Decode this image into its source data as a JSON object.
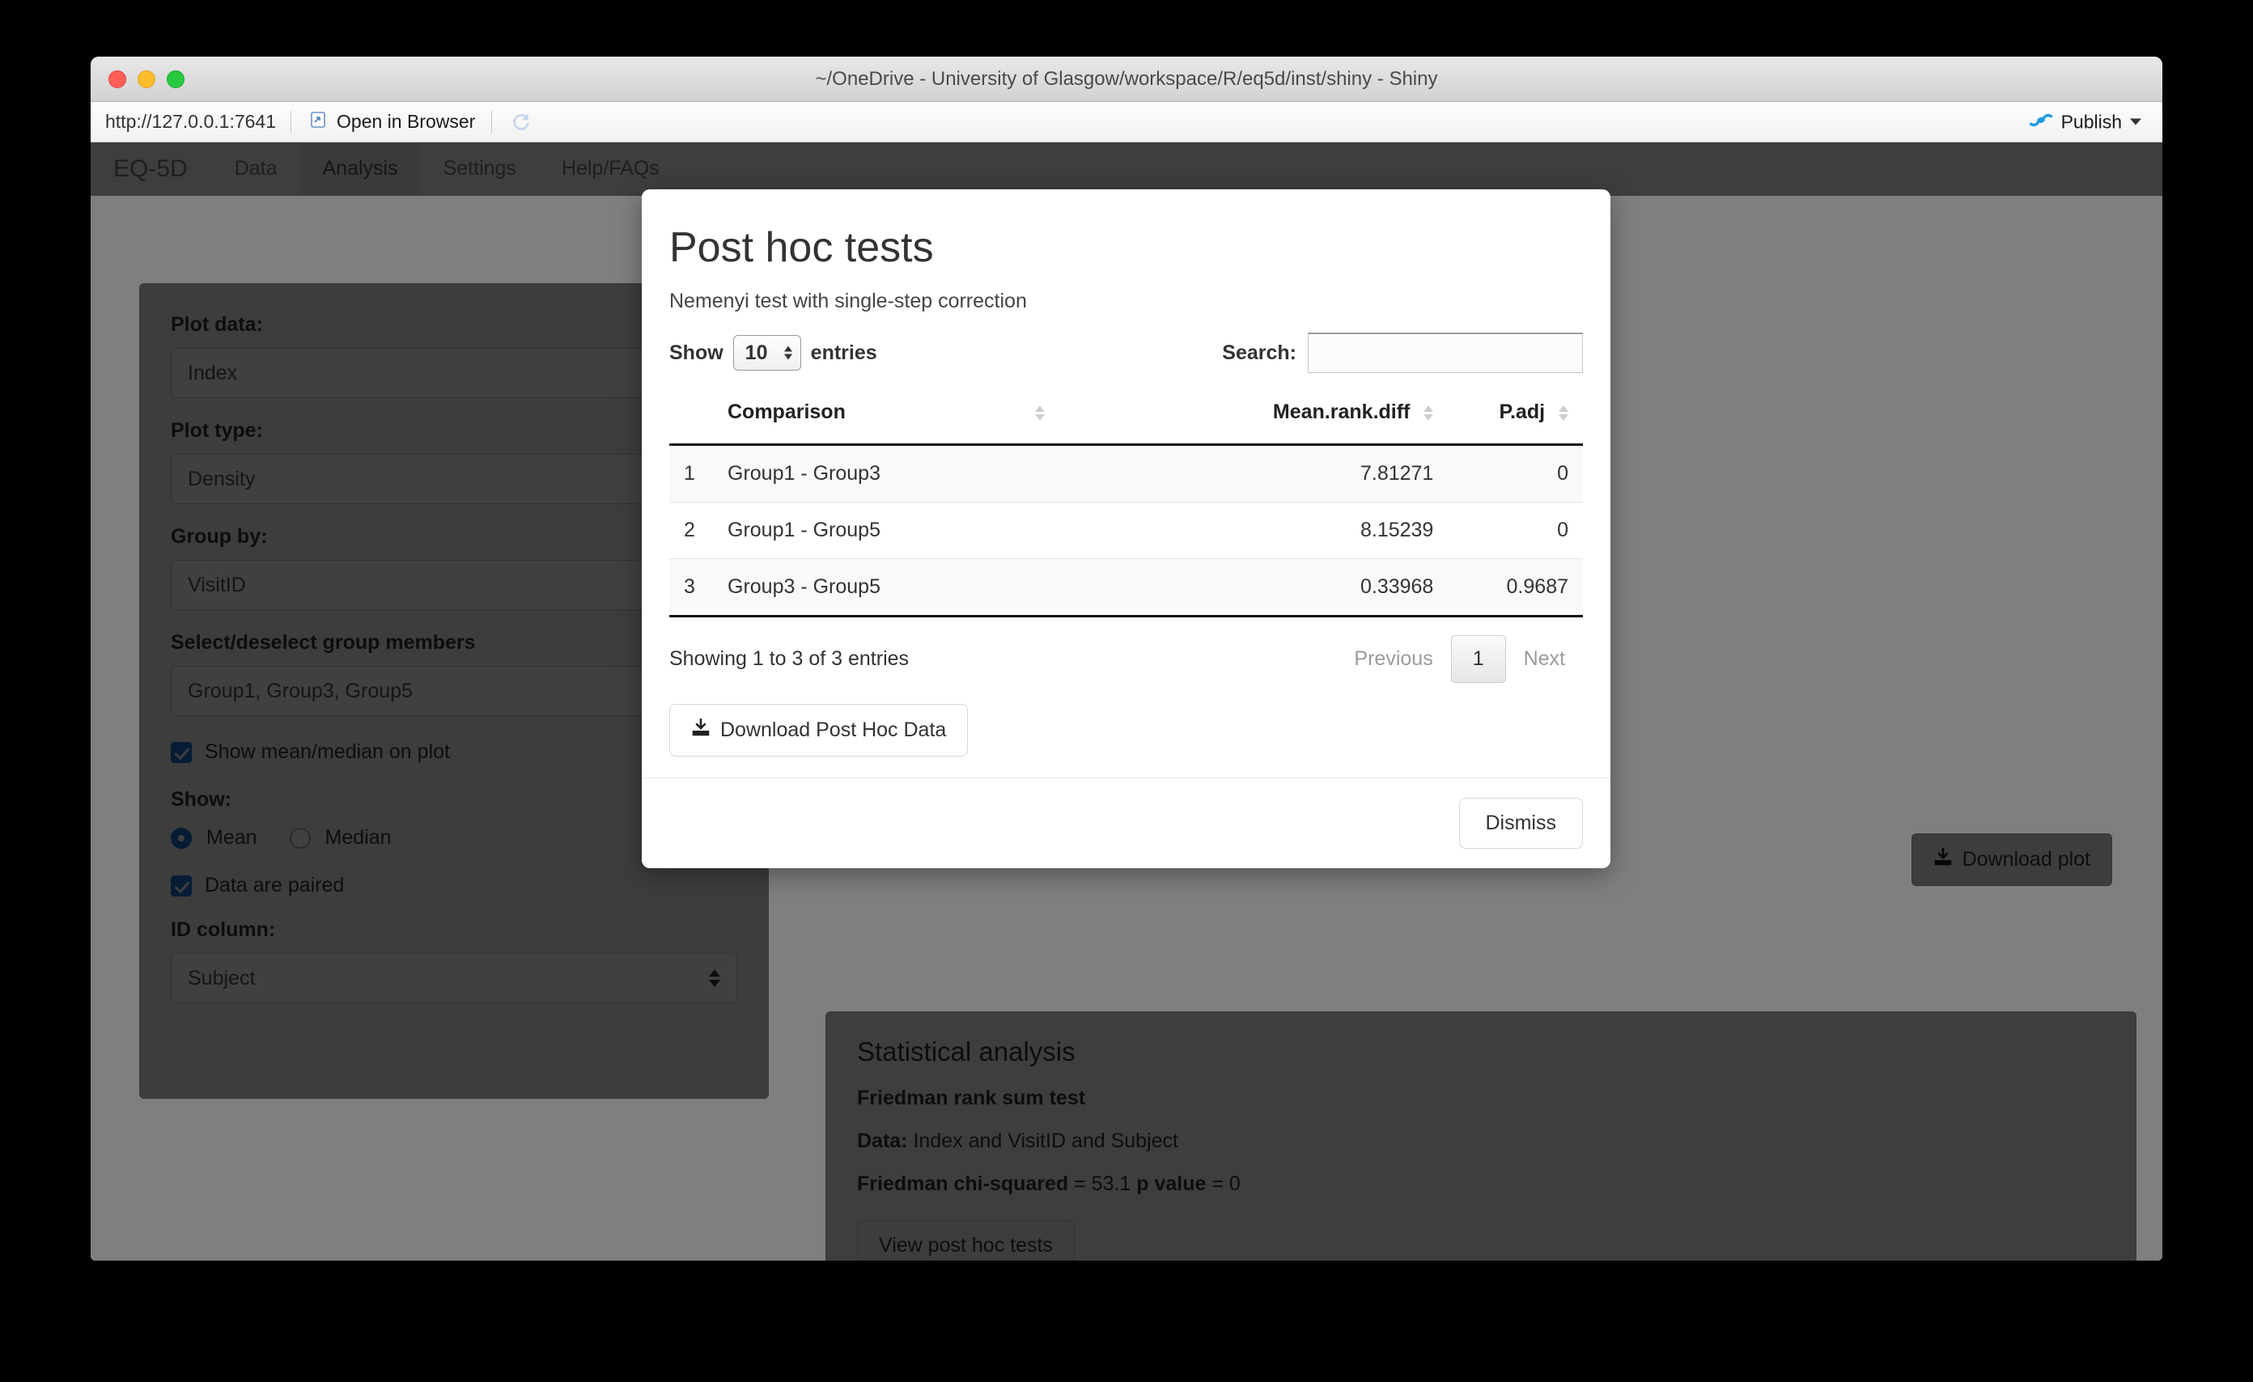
{
  "window": {
    "title": "~/OneDrive - University of Glasgow/workspace/R/eq5d/inst/shiny - Shiny"
  },
  "toolbar": {
    "url": "http://127.0.0.1:7641",
    "open_in_browser": "Open in Browser",
    "refresh_icon": "refresh-icon",
    "publish_label": "Publish",
    "publish_icon": "publish-icon"
  },
  "nav": {
    "brand": "EQ-5D",
    "tabs": [
      {
        "label": "Data",
        "active": false
      },
      {
        "label": "Analysis",
        "active": true
      },
      {
        "label": "Settings",
        "active": false
      },
      {
        "label": "Help/FAQs",
        "active": false
      }
    ]
  },
  "sidebar": {
    "plot_data_label": "Plot data:",
    "plot_data_value": "Index",
    "plot_type_label": "Plot type:",
    "plot_type_value": "Density",
    "group_by_label": "Group by:",
    "group_by_value": "VisitID",
    "group_members_label": "Select/deselect group members",
    "group_members_value": "Group1, Group3, Group5",
    "show_mean_median_label": "Show mean/median on plot",
    "show_mean_median_checked": true,
    "show_label": "Show:",
    "radio_mean": "Mean",
    "radio_median": "Median",
    "radio_selected": "Mean",
    "data_are_paired_label": "Data are paired",
    "data_are_paired_checked": true,
    "id_column_label": "ID column:",
    "id_column_value": "Subject"
  },
  "main": {
    "download_plot_label": "Download plot",
    "download_icon": "download-icon"
  },
  "stats": {
    "title": "Statistical analysis",
    "test_name": "Friedman rank sum test",
    "data_label": "Data:",
    "data_value": " Index and VisitID and Subject",
    "chisq_label": "Friedman chi-squared",
    "chisq_eq": " = 53.1 ",
    "pvalue_label": "p value",
    "pvalue_eq": " = 0",
    "view_posthoc_label": "View post hoc tests"
  },
  "modal": {
    "title": "Post hoc tests",
    "subtitle": "Nemenyi test with single-step correction",
    "show_prefix": "Show",
    "entries_value": "10",
    "show_suffix": "entries",
    "search_label": "Search:",
    "search_value": "",
    "search_placeholder": "",
    "info": "Showing 1 to 3 of 3 entries",
    "previous_label": "Previous",
    "page_number": "1",
    "next_label": "Next",
    "download_label": "Download Post Hoc Data",
    "download_icon": "download-icon",
    "dismiss_label": "Dismiss",
    "columns": [
      "",
      "Comparison",
      "Mean.rank.diff",
      "P.adj"
    ],
    "rows": [
      {
        "idx": "1",
        "comparison": "Group1 - Group3",
        "mean_rank_diff": "7.81271",
        "p_adj": "0"
      },
      {
        "idx": "2",
        "comparison": "Group1 - Group5",
        "mean_rank_diff": "8.15239",
        "p_adj": "0"
      },
      {
        "idx": "3",
        "comparison": "Group3 - Group5",
        "mean_rank_diff": "0.33968",
        "p_adj": "0.9687"
      }
    ]
  },
  "colors": {
    "accent_blue": "#1a6fd4",
    "publish_blue": "#1e9ae0",
    "traffic_red": "#ff5f57",
    "traffic_yellow": "#ffbd2e",
    "traffic_green": "#28c940"
  }
}
